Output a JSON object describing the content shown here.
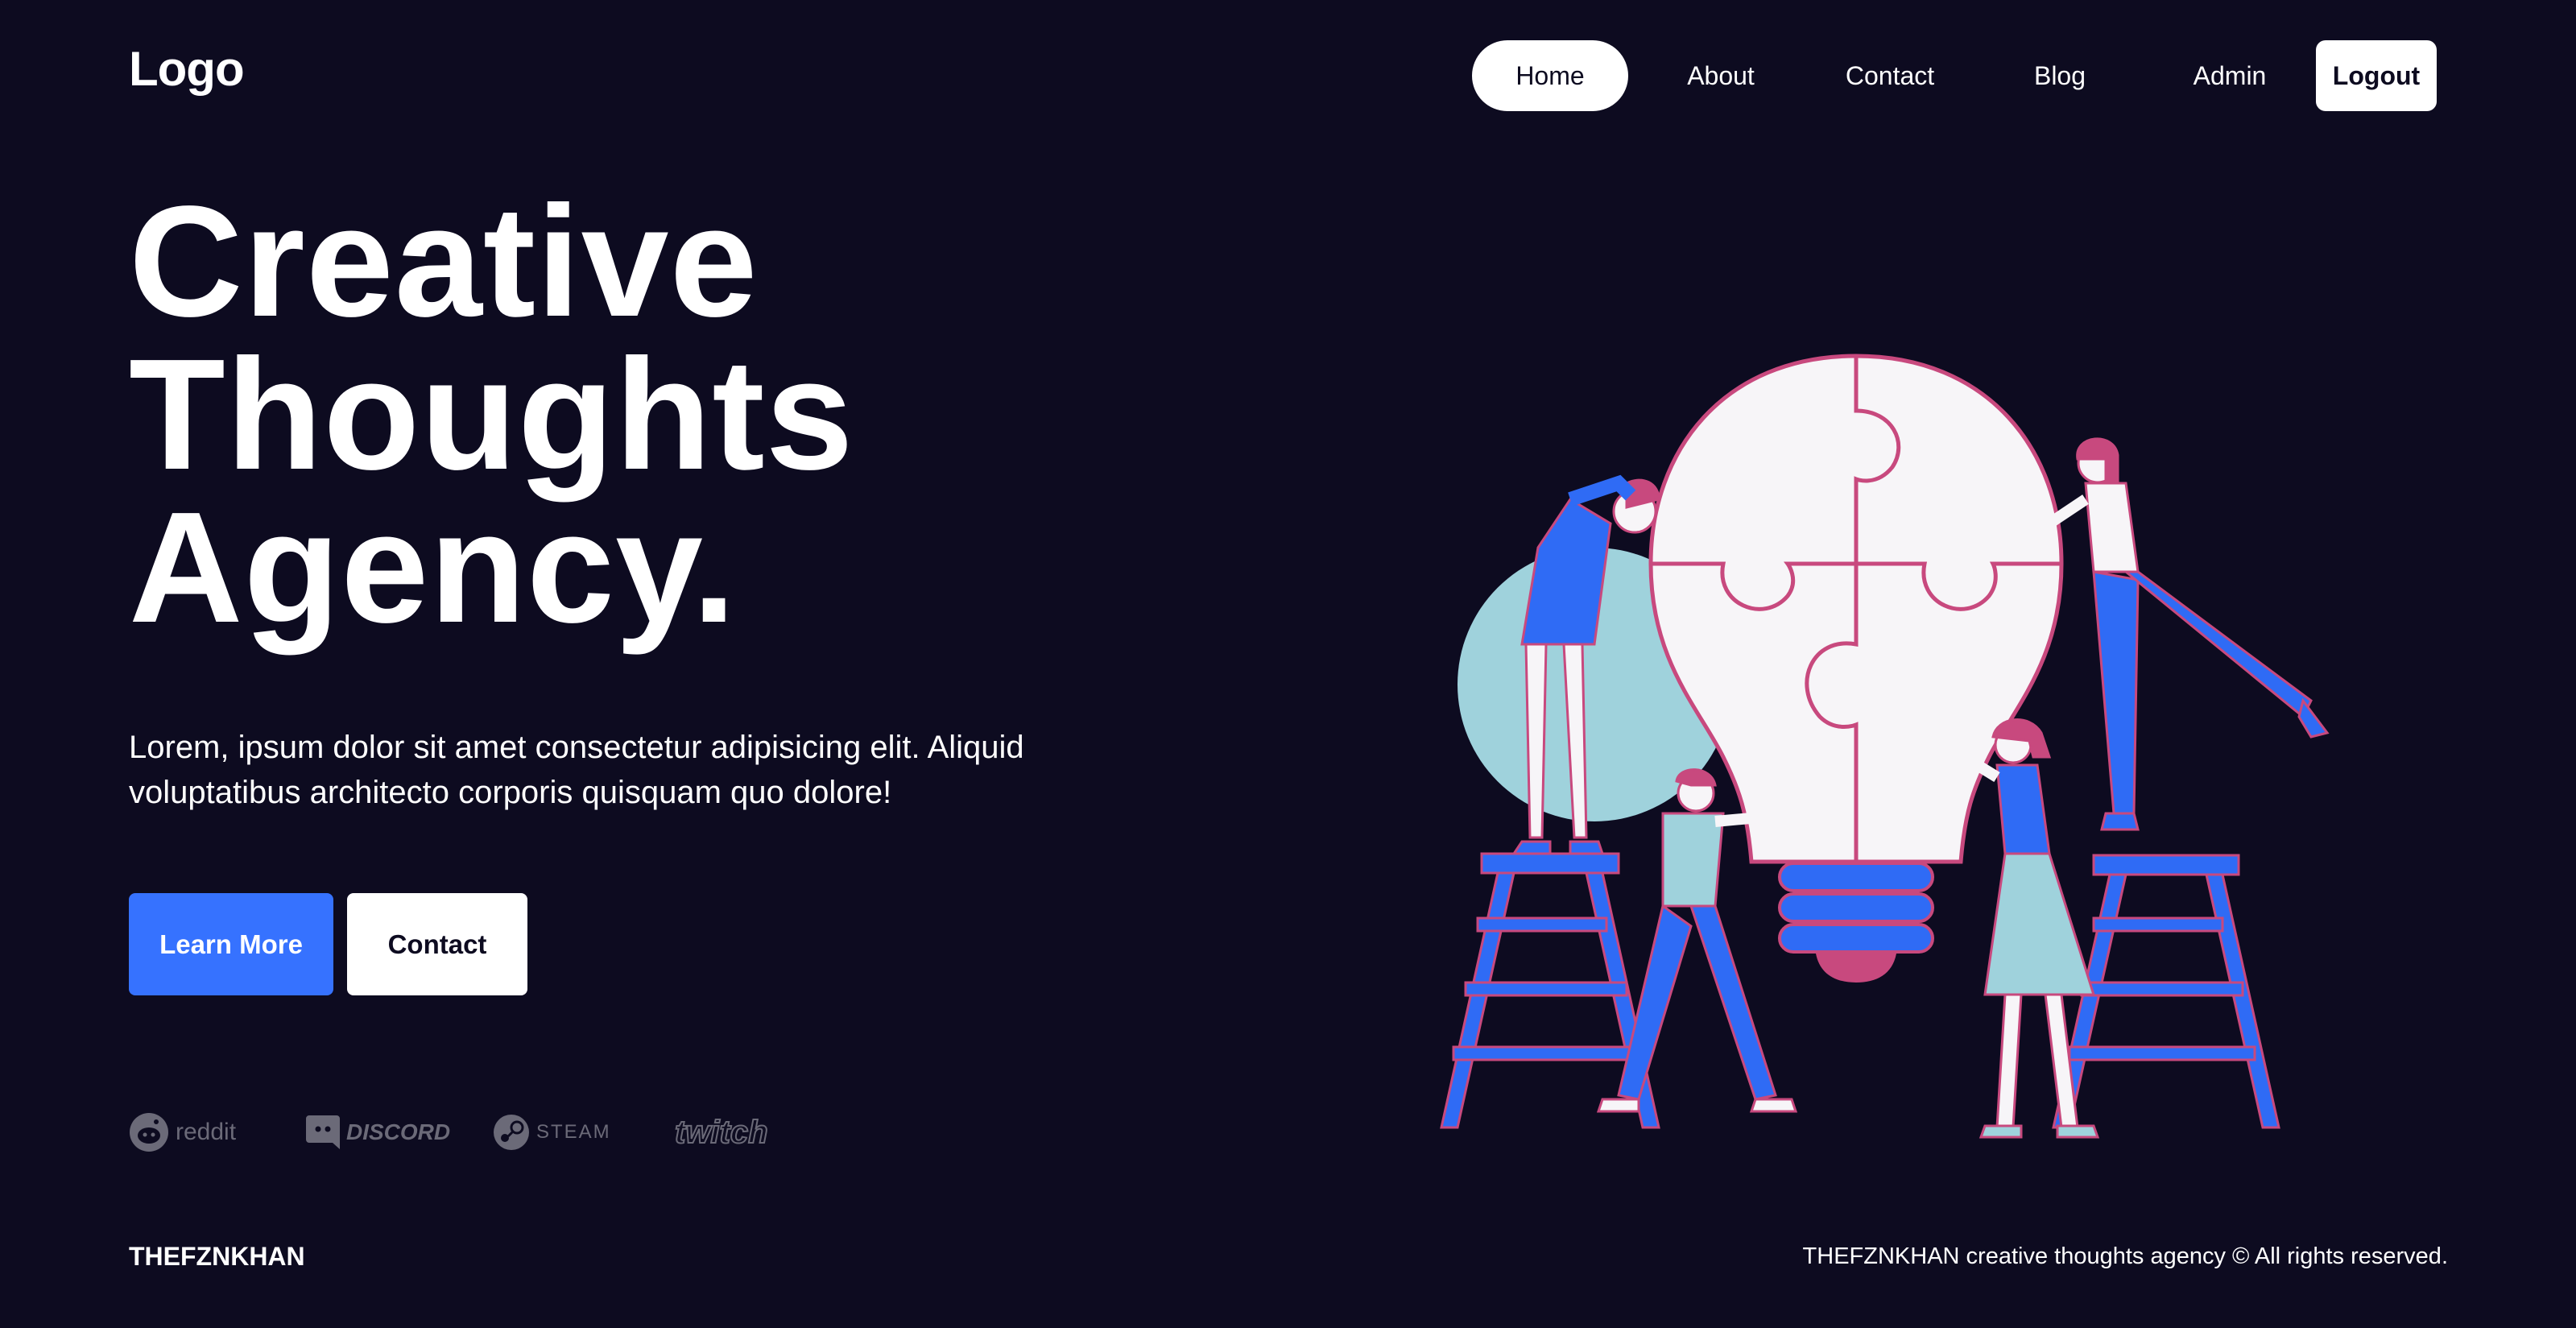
{
  "header": {
    "logo": "Logo",
    "nav": {
      "home": "Home",
      "about": "About",
      "contact": "Contact",
      "blog": "Blog",
      "admin": "Admin",
      "logout": "Logout"
    }
  },
  "hero": {
    "title_line1": "Creative",
    "title_line2": "Thoughts",
    "title_line3": "Agency.",
    "description": "Lorem, ipsum dolor sit amet consectetur adipisicing elit. Aliquid voluptatibus architecto corporis quisquam quo dolore!",
    "primary_button": "Learn More",
    "secondary_button": "Contact"
  },
  "partners": {
    "reddit": "reddit",
    "discord": "DISCORD",
    "steam": "STEAM",
    "twitch": "twitch"
  },
  "footer": {
    "brand": "THEFZNKHAN",
    "copyright": "THEFZNKHAN creative thoughts agency © All rights reserved."
  },
  "colors": {
    "background": "#0d0b20",
    "primary": "#3672ff",
    "text": "#ffffff",
    "muted": "#6b6a78",
    "illustration_blue": "#2f6bf5",
    "illustration_pink": "#c8497e",
    "illustration_teal": "#9fd2dc"
  }
}
